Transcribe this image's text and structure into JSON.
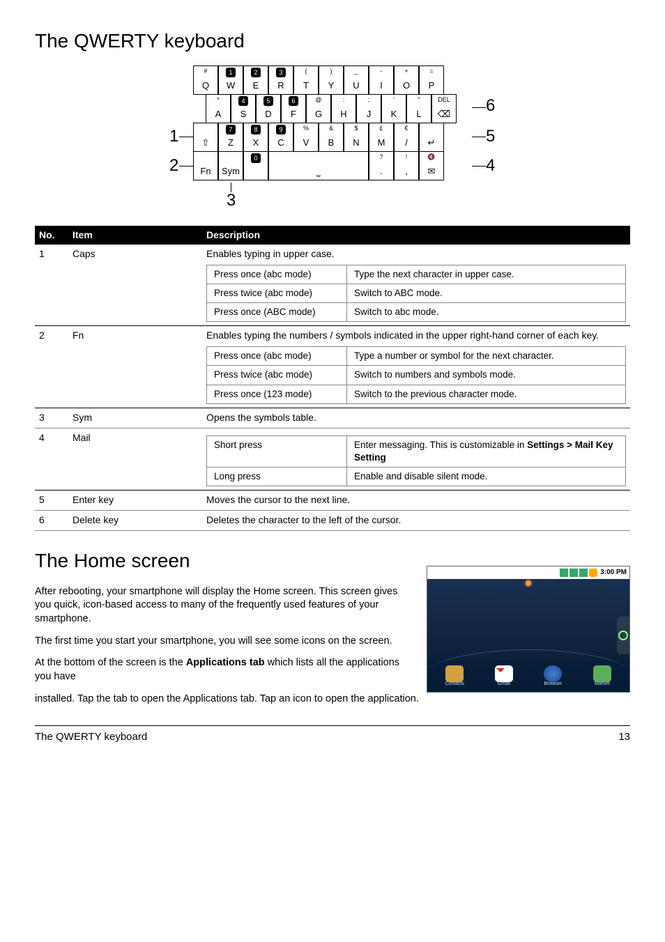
{
  "headings": {
    "title1": "The QWERTY keyboard",
    "title2": "The Home screen"
  },
  "diagram": {
    "annots": {
      "a1": "1",
      "a2": "2",
      "a3": "3",
      "a4": "4",
      "a5": "5",
      "a6": "6"
    },
    "rows": [
      {
        "offset": 0,
        "keys": [
          {
            "top": "#",
            "main": "Q"
          },
          {
            "top_bubble": "1",
            "main": "W"
          },
          {
            "top_bubble": "2",
            "main": "E"
          },
          {
            "top_bubble": "3",
            "main": "R"
          },
          {
            "top": "(",
            "main": "T"
          },
          {
            "top": ")",
            "main": "Y"
          },
          {
            "top": "_",
            "main": "U"
          },
          {
            "top": "-",
            "main": "I"
          },
          {
            "top": "+",
            "main": "O"
          },
          {
            "top": "=",
            "main": "P"
          }
        ]
      },
      {
        "offset": 18,
        "keys": [
          {
            "top": "*",
            "main": "A"
          },
          {
            "top_bubble": "4",
            "main": "S"
          },
          {
            "top_bubble": "5",
            "main": "D",
            "mid": "°"
          },
          {
            "top_bubble": "6",
            "main": "F"
          },
          {
            "top": "@",
            "main": "G"
          },
          {
            "top": ":",
            "main": "H"
          },
          {
            "top": ";",
            "main": "J"
          },
          {
            "top": "'",
            "main": "K"
          },
          {
            "top": "\"",
            "main": "L"
          },
          {
            "top": "DEL",
            "main": "⌫"
          }
        ]
      },
      {
        "offset": 0,
        "keys": [
          {
            "top": "",
            "main": "⇧"
          },
          {
            "top_bubble": "7",
            "main": "Z"
          },
          {
            "top_bubble": "8",
            "main": "X"
          },
          {
            "top_bubble": "9",
            "main": "C"
          },
          {
            "top": "%",
            "main": "V"
          },
          {
            "top": "&",
            "main": "B"
          },
          {
            "top": "$",
            "main": "N"
          },
          {
            "top": "£",
            "main": "M"
          },
          {
            "top": "€",
            "main": "/"
          },
          {
            "top": "",
            "main": "↵"
          }
        ]
      },
      {
        "offset": 0,
        "keys": [
          {
            "main": "Fn"
          },
          {
            "main": "Sym"
          },
          {
            "top_bubble": "0",
            "main": ""
          },
          {
            "space": true,
            "width": 4
          },
          {
            "top": "?",
            "main": "."
          },
          {
            "top": "!",
            "main": ","
          },
          {
            "top": "🔇",
            "main": "✉"
          }
        ]
      }
    ]
  },
  "table": {
    "headers": {
      "no": "No.",
      "item": "Item",
      "desc": "Description"
    },
    "rows": [
      {
        "no": "1",
        "item": "Caps",
        "desc": "Enables typing in upper case.",
        "inner": [
          [
            "Press once (abc mode)",
            "Type the next character in upper case."
          ],
          [
            "Press twice (abc mode)",
            "Switch to ABC mode."
          ],
          [
            "Press once (ABC mode)",
            "Switch to abc mode."
          ]
        ]
      },
      {
        "no": "2",
        "item": "Fn",
        "desc": "Enables typing the numbers / symbols indicated in the upper right-hand corner of each key.",
        "inner": [
          [
            "Press once (abc mode)",
            "Type a number or symbol for the next character."
          ],
          [
            "Press twice (abc mode)",
            "Switch to numbers and symbols mode."
          ],
          [
            "Press once (123 mode)",
            "Switch to the previous character mode."
          ]
        ]
      },
      {
        "no": "3",
        "item": "Sym",
        "desc": "Opens the symbols table."
      },
      {
        "no": "4",
        "item": "Mail",
        "desc": "",
        "inner": [
          [
            "Short press",
            "Enter messaging. This is customizable in <b>Settings > Mail Key Setting</b>"
          ],
          [
            "Long press",
            "Enable and disable silent mode."
          ]
        ]
      },
      {
        "no": "5",
        "item": "Enter key",
        "desc": "Moves the cursor to the next line."
      },
      {
        "no": "6",
        "item": "Delete key",
        "desc": "Deletes the character to the left of the cursor."
      }
    ]
  },
  "home": {
    "p1": "After rebooting, your smartphone will display the Home screen. This screen gives you quick, icon-based access to many of the frequently used features of your smartphone.",
    "p2": "The first time you start your smartphone, you will see some icons on the screen.",
    "p3_a": "At the bottom of the screen is the ",
    "p3_b": "Applications tab",
    "p3_c": " which lists all the applications you have installed. Tap the tab to open the Applications tab. Tap an icon to open the application.",
    "time": "3:00 PM",
    "dock": [
      "Contacts",
      "Gmail",
      "Browser",
      "Market"
    ]
  },
  "footer": {
    "left": "The QWERTY keyboard",
    "right": "13"
  }
}
